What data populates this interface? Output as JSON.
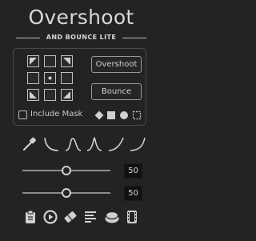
{
  "header": {
    "title": "Overshoot",
    "subtitle": "AND BOUNCE LITE"
  },
  "anchor_grid": {
    "selected": "center",
    "cells": [
      "top-left",
      "top",
      "top-right",
      "left",
      "center",
      "right",
      "bottom-left",
      "bottom",
      "bottom-right"
    ]
  },
  "buttons": {
    "overshoot_label": "Overshoot",
    "bounce_label": "Bounce"
  },
  "include_mask": {
    "label": "Include Mask",
    "checked": false
  },
  "shape_icons": [
    "diamond-icon",
    "square-icon",
    "circle-icon",
    "dashed-square-icon"
  ],
  "curve_presets": [
    "eyedropper-icon",
    "ease-out-curve-icon",
    "ease-in-out-curve-icon",
    "peak-curve-icon",
    "ease-in-curve-icon",
    "linear-curve-icon"
  ],
  "sliders": [
    {
      "value": "50",
      "fraction": 0.5
    },
    {
      "value": "50",
      "fraction": 0.5
    }
  ],
  "toolbar": [
    "clipboard-icon",
    "play-settings-icon",
    "eraser-icon",
    "align-icon",
    "layers-icon",
    "film-icon"
  ],
  "colors": {
    "background": "#232323",
    "text": "#d9d9d9",
    "border": "#4a4a4a"
  }
}
